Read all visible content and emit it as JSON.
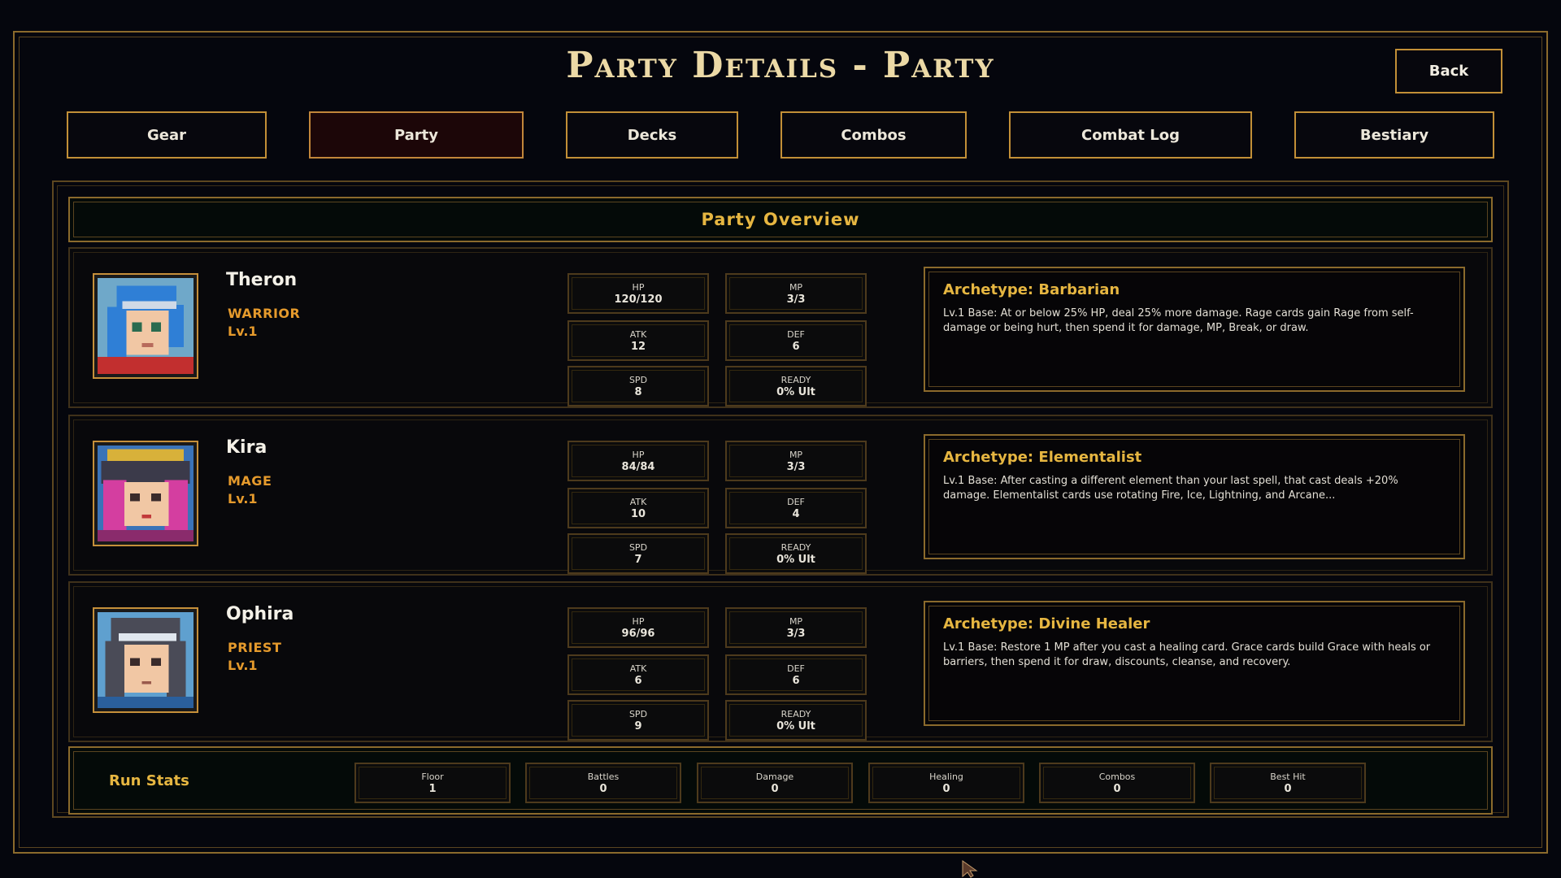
{
  "header": {
    "title": "Party Details - Party",
    "back_label": "Back"
  },
  "tabs": [
    {
      "label": "Gear",
      "active": false
    },
    {
      "label": "Party",
      "active": true
    },
    {
      "label": "Decks",
      "active": false
    },
    {
      "label": "Combos",
      "active": false
    },
    {
      "label": "Combat Log",
      "active": false
    },
    {
      "label": "Bestiary",
      "active": false
    }
  ],
  "overview_title": "Party Overview",
  "party": [
    {
      "name": "Theron",
      "class": "WARRIOR",
      "level": "Lv.1",
      "stats": {
        "hp_label": "HP",
        "hp": "120/120",
        "mp_label": "MP",
        "mp": "3/3",
        "atk_label": "ATK",
        "atk": "12",
        "def_label": "DEF",
        "def": "6",
        "spd_label": "SPD",
        "spd": "8",
        "ready_label": "READY",
        "ready": "0% Ult"
      },
      "archetype_title": "Archetype: Barbarian",
      "archetype_desc": "Lv.1  Base: At or below 25% HP, deal 25% more damage. Rage cards gain Rage from self-damage or being hurt, then spend it for damage, MP, Break, or draw."
    },
    {
      "name": "Kira",
      "class": "MAGE",
      "level": "Lv.1",
      "stats": {
        "hp_label": "HP",
        "hp": "84/84",
        "mp_label": "MP",
        "mp": "3/3",
        "atk_label": "ATK",
        "atk": "10",
        "def_label": "DEF",
        "def": "4",
        "spd_label": "SPD",
        "spd": "7",
        "ready_label": "READY",
        "ready": "0% Ult"
      },
      "archetype_title": "Archetype: Elementalist",
      "archetype_desc": "Lv.1  Base: After casting a different element than your last spell, that cast deals +20% damage. Elementalist cards use rotating Fire, Ice, Lightning, and Arcane..."
    },
    {
      "name": "Ophira",
      "class": "PRIEST",
      "level": "Lv.1",
      "stats": {
        "hp_label": "HP",
        "hp": "96/96",
        "mp_label": "MP",
        "mp": "3/3",
        "atk_label": "ATK",
        "atk": "6",
        "def_label": "DEF",
        "def": "6",
        "spd_label": "SPD",
        "spd": "9",
        "ready_label": "READY",
        "ready": "0% Ult"
      },
      "archetype_title": "Archetype: Divine Healer",
      "archetype_desc": "Lv.1  Base: Restore 1 MP after you cast a healing card. Grace cards build Grace with heals or barriers, then spend it for draw, discounts, cleanse, and recovery."
    }
  ],
  "run_stats": {
    "label": "Run Stats",
    "items": [
      {
        "label": "Floor",
        "value": "1"
      },
      {
        "label": "Battles",
        "value": "0"
      },
      {
        "label": "Damage",
        "value": "0"
      },
      {
        "label": "Healing",
        "value": "0"
      },
      {
        "label": "Combos",
        "value": "0"
      },
      {
        "label": "Best Hit",
        "value": "0"
      }
    ]
  },
  "colors": {
    "accent_gold": "#e6b641",
    "border_gold": "#c28f37",
    "class_orange": "#e59a2c",
    "active_tab_bg": "#1c0608"
  },
  "icons": {
    "portrait_1": "warrior-portrait-icon",
    "portrait_2": "mage-portrait-icon",
    "portrait_3": "priest-portrait-icon",
    "cursor": "mouse-pointer-icon"
  }
}
